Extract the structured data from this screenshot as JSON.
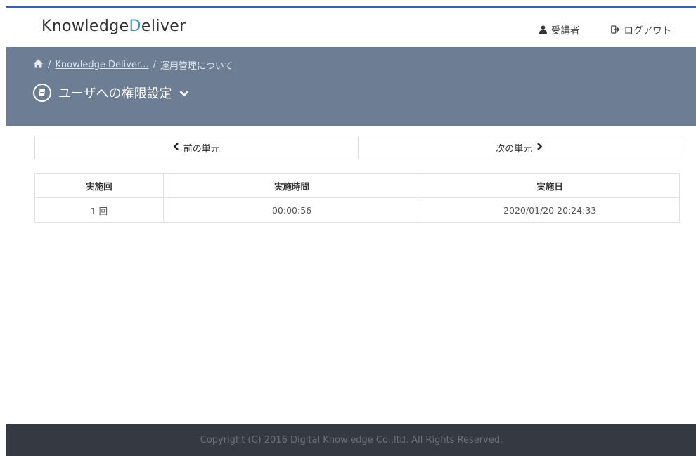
{
  "header": {
    "logo_part1": "Knowledge",
    "logo_part2": "Deliver",
    "user_label": "受講者",
    "logout_label": "ログアウト"
  },
  "breadcrumb": {
    "items": [
      "Knowledge Deliver...",
      "運用管理について"
    ],
    "separator": "/"
  },
  "page": {
    "title": "ユーザへの権限設定"
  },
  "unit_nav": {
    "prev_label": "前の単元",
    "next_label": "次の単元"
  },
  "table": {
    "headers": [
      "実施回",
      "実施時間",
      "実施日"
    ],
    "rows": [
      [
        "1 回",
        "00:00:56",
        "2020/01/20 20:24:33"
      ]
    ]
  },
  "footer": {
    "copyright": "Copyright (C) 2016 Digital Knowledge Co.,ltd. All Rights Reserved."
  },
  "colors": {
    "title_bar": "#6c7d94",
    "logo_accent": "#3d8fd6",
    "footer_bg": "#353a42",
    "top_line": "#3a5fb0"
  }
}
